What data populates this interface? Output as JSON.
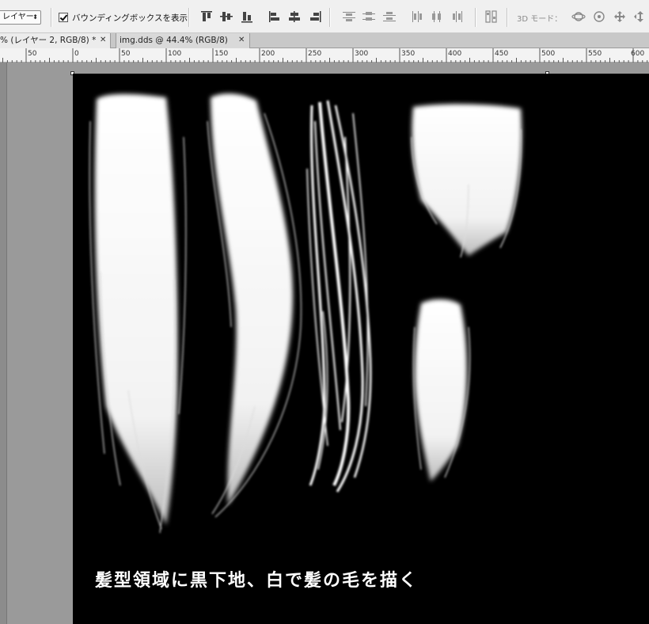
{
  "options_bar": {
    "layer_select_value": "レイヤー",
    "show_bounding_box_checked": true,
    "show_bounding_box_label": "バウンディングボックスを表示",
    "mode_3d_label": "3D モード：",
    "align_icons": [
      "align-top-icon",
      "align-vertical-center-icon",
      "align-bottom-icon",
      "align-left-icon",
      "align-horizontal-center-icon",
      "align-right-icon"
    ],
    "distribute_icons": [
      "distribute-top-icon",
      "distribute-vcenter-icon",
      "distribute-bottom-icon",
      "distribute-left-icon",
      "distribute-hcenter-icon",
      "distribute-right-icon"
    ],
    "mode_3d_icons": [
      "rotate-3d-icon",
      "roll-3d-icon",
      "pan-3d-icon",
      "slide-3d-icon"
    ]
  },
  "tabs": [
    {
      "label": "% (レイヤー 2, RGB/8) *",
      "active": true
    },
    {
      "label": "img.dds @ 44.4% (RGB/8)",
      "active": false
    }
  ],
  "ruler": {
    "labels": [
      "50",
      "0",
      "50",
      "100",
      "150",
      "200",
      "250",
      "300",
      "350",
      "400",
      "450",
      "500",
      "550",
      "600"
    ]
  },
  "canvas": {
    "caption": "髪型領域に黒下地、白で髪の毛を描く",
    "background_color": "#000000",
    "hair_color": "#ffffff"
  }
}
